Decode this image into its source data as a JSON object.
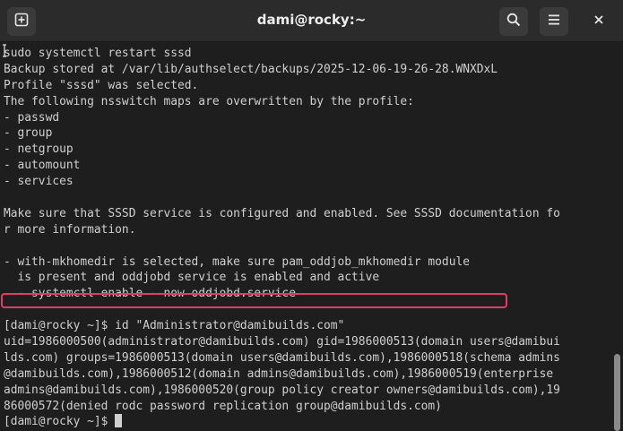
{
  "window": {
    "title": "dami@rocky:~"
  },
  "toolbar": {
    "new_tab_icon": "new-tab-icon",
    "search_icon": "search-icon",
    "menu_icon": "hamburger-menu-icon",
    "close_icon": "close-icon"
  },
  "terminal": {
    "lines": [
      "sudo systemctl restart sssd",
      "Backup stored at /var/lib/authselect/backups/2025-12-06-19-26-28.WNXDxL",
      "Profile \"sssd\" was selected.",
      "The following nsswitch maps are overwritten by the profile:",
      "- passwd",
      "- group",
      "- netgroup",
      "- automount",
      "- services",
      "",
      "Make sure that SSSD service is configured and enabled. See SSSD documentation fo",
      "r more information.",
      "",
      "- with-mkhomedir is selected, make sure pam_oddjob_mkhomedir module",
      "  is present and oddjobd service is enabled and active",
      "  - systemctl enable --now oddjobd.service",
      "",
      "[dami@rocky ~]$ id \"Administrator@damibuilds.com\"",
      "uid=1986000500(administrator@damibuilds.com) gid=1986000513(domain users@damibui",
      "lds.com) groups=1986000513(domain users@damibuilds.com),1986000518(schema admins",
      "@damibuilds.com),1986000512(domain admins@damibuilds.com),1986000519(enterprise ",
      "admins@damibuilds.com),1986000520(group policy creator owners@damibuilds.com),19",
      "86000572(denied rodc password replication group@damibuilds.com)"
    ],
    "prompt": "[dami@rocky ~]$ "
  },
  "colors": {
    "background": "#1e1e1e",
    "titlebar": "#2b2b2b",
    "text": "#d0d0d0",
    "highlight": "#e03c6a"
  }
}
